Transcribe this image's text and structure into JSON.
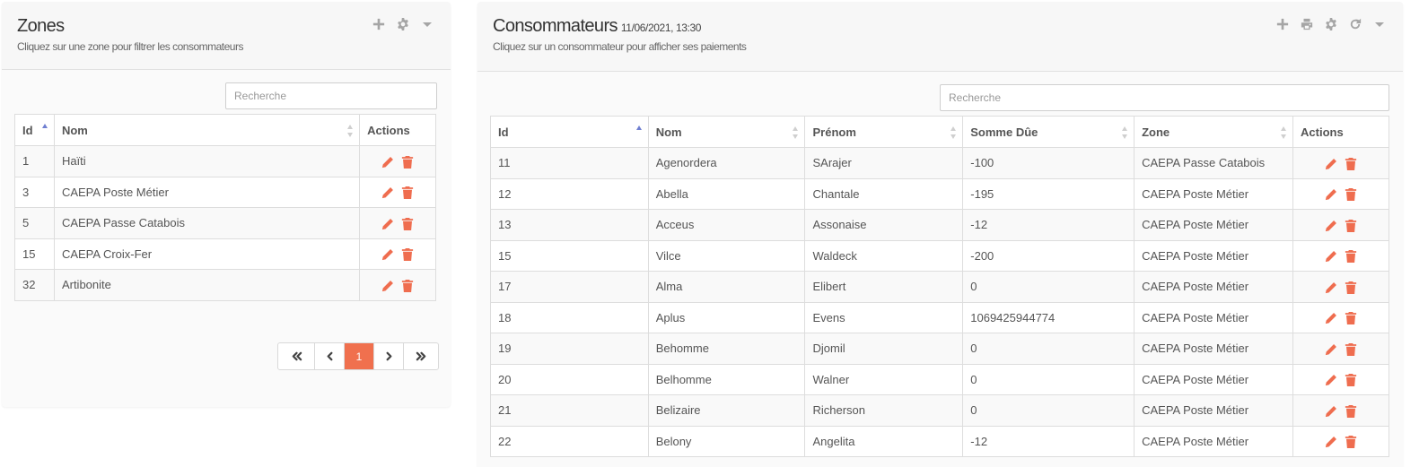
{
  "zones": {
    "title": "Zones",
    "subtitle": "Cliquez sur une zone pour filtrer les consommateurs",
    "tools": [
      "plus-icon",
      "gear-icon",
      "caret-down-icon"
    ],
    "search": {
      "placeholder": "Recherche",
      "value": ""
    },
    "columns": [
      "Id",
      "Nom",
      "Actions"
    ],
    "sort": {
      "column": "Id",
      "direction": "asc"
    },
    "rows": [
      {
        "id": "1",
        "nom": "Haïti"
      },
      {
        "id": "3",
        "nom": "CAEPA Poste Métier"
      },
      {
        "id": "5",
        "nom": "CAEPA Passe Catabois"
      },
      {
        "id": "15",
        "nom": "CAEPA Croix-Fer"
      },
      {
        "id": "32",
        "nom": "Artibonite"
      }
    ],
    "pagination": {
      "current": "1",
      "controls": [
        "first-page-icon",
        "prev-page-icon",
        "next-page-icon",
        "last-page-icon"
      ]
    }
  },
  "consommateurs": {
    "title": "Consommateurs",
    "timestamp": "11/06/2021, 13:30",
    "subtitle": "Cliquez sur un consommateur pour afficher ses paiements",
    "tools": [
      "plus-icon",
      "print-icon",
      "gear-icon",
      "refresh-icon",
      "caret-down-icon"
    ],
    "search": {
      "placeholder": "Recherche",
      "value": ""
    },
    "columns": [
      "Id",
      "Nom",
      "Prénom",
      "Somme Dûe",
      "Zone",
      "Actions"
    ],
    "sort": {
      "column": "Id",
      "direction": "asc"
    },
    "rows": [
      {
        "id": "11",
        "nom": "Agenordera",
        "prenom": "SArajer",
        "somme": "-100",
        "zone": "CAEPA Passe Catabois"
      },
      {
        "id": "12",
        "nom": "Abella",
        "prenom": "Chantale",
        "somme": "-195",
        "zone": "CAEPA Poste Métier"
      },
      {
        "id": "13",
        "nom": "Acceus",
        "prenom": "Assonaise",
        "somme": "-12",
        "zone": "CAEPA Poste Métier"
      },
      {
        "id": "15",
        "nom": "Vilce",
        "prenom": "Waldeck",
        "somme": "-200",
        "zone": "CAEPA Poste Métier"
      },
      {
        "id": "17",
        "nom": "Alma",
        "prenom": "Elibert",
        "somme": "0",
        "zone": "CAEPA Poste Métier"
      },
      {
        "id": "18",
        "nom": "Aplus",
        "prenom": "Evens",
        "somme": "1069425944774",
        "zone": "CAEPA Poste Métier"
      },
      {
        "id": "19",
        "nom": "Behomme",
        "prenom": "Djomil",
        "somme": "0",
        "zone": "CAEPA Poste Métier"
      },
      {
        "id": "20",
        "nom": "Belhomme",
        "prenom": "Walner",
        "somme": "0",
        "zone": "CAEPA Poste Métier"
      },
      {
        "id": "21",
        "nom": "Belizaire",
        "prenom": "Richerson",
        "somme": "0",
        "zone": "CAEPA Poste Métier"
      },
      {
        "id": "22",
        "nom": "Belony",
        "prenom": "Angelita",
        "somme": "-12",
        "zone": "CAEPA Poste Métier"
      }
    ]
  },
  "colors": {
    "accent": "#f0704e",
    "action_icon": "#ef6d4f",
    "sort_active": "#6f7fd1"
  }
}
